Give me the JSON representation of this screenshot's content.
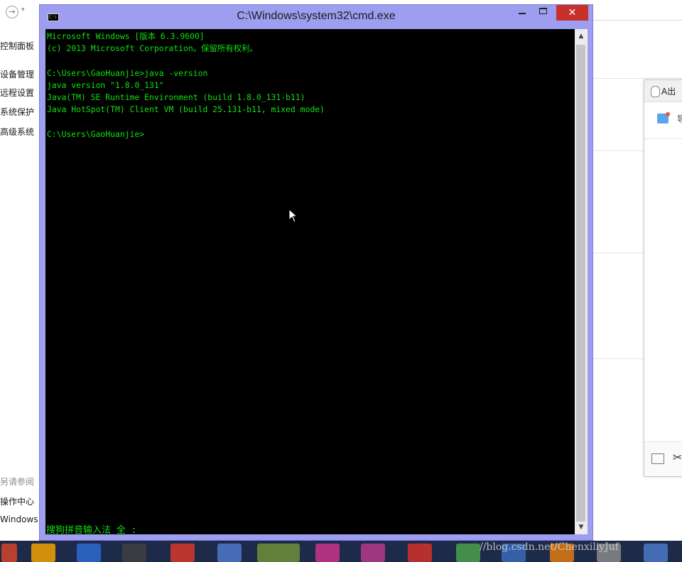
{
  "background": {
    "nav_forward": "→",
    "nav_dropdown": "▾",
    "sidebar_links": [
      "控制面板",
      "设备管理",
      "远程设置",
      "系统保护",
      "高级系统"
    ],
    "see_also": "另请参阅",
    "bottom_links": [
      "操作中心",
      "Windows"
    ]
  },
  "cmd": {
    "icon_label": "C:\\",
    "title": "C:\\Windows\\system32\\cmd.exe",
    "minimize_label": "",
    "maximize_label": "",
    "close_label": "✕",
    "console_text": "Microsoft Windows [版本 6.3.9600]\n(c) 2013 Microsoft Corporation。保留所有权利。\n\nC:\\Users\\GaoHuanjie>java -version\njava version \"1.8.0_131\"\nJava(TM) SE Runtime Environment (build 1.8.0_131-b11)\nJava HotSpot(TM) Client VM (build 25.131-b11, mixed mode)\n\nC:\\Users\\GaoHuanjie>",
    "ime_status": "搜狗拼音输入法 全 :",
    "scroll_up": "▲",
    "scroll_down": "▼"
  },
  "qq_panel": {
    "title": "A出",
    "tool_text": "导",
    "scissors": "✂"
  },
  "taskbar": {
    "watermark": "//blog.csdn.net/ChenxiliyJuf",
    "colors": [
      "#d2452b",
      "#f2a100",
      "#2a6ad0",
      "#3f3f3f",
      "#d63a2a",
      "#4d78c8",
      "#6e8f3a",
      "#c8348a",
      "#b43a8a",
      "#d2302a",
      "#4aa04a",
      "#3a6ab8",
      "#e07a12",
      "#888888",
      "#4a78c8"
    ]
  }
}
